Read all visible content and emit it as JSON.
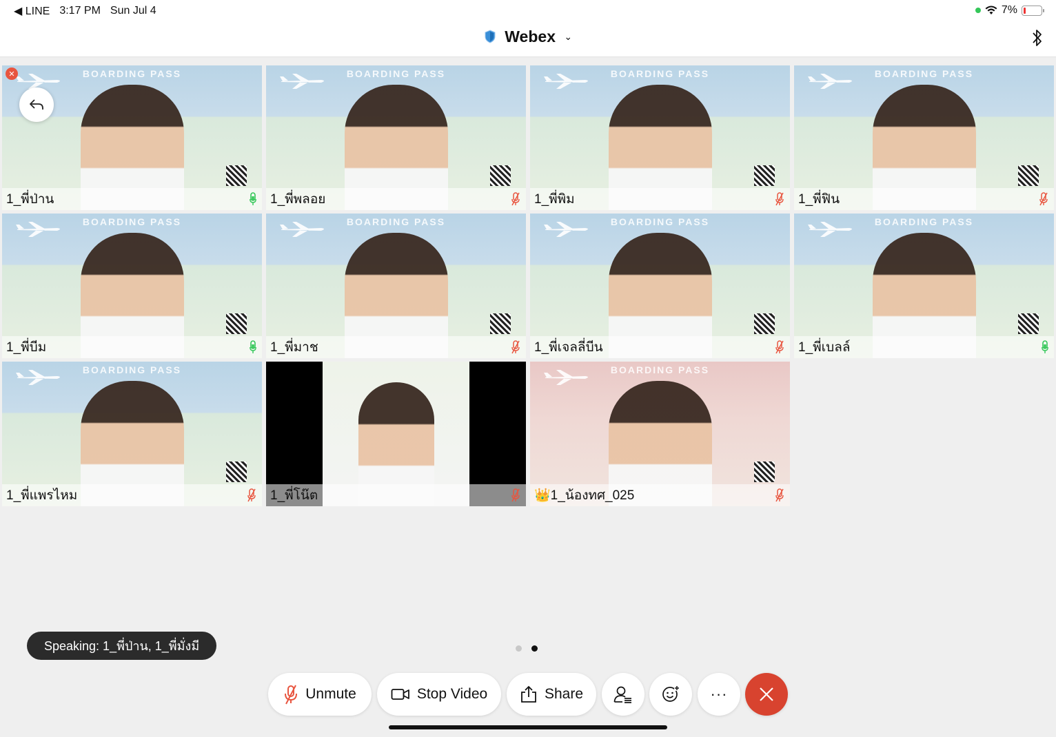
{
  "status_bar": {
    "back_app": "◀ LINE",
    "time": "3:17 PM",
    "date": "Sun Jul 4",
    "battery": "7%"
  },
  "header": {
    "title": "Webex",
    "chevron": "⌄"
  },
  "tile_overlay": {
    "banner": "BOARDING PASS"
  },
  "participants": [
    {
      "name": "1_พี่ป่าน",
      "mic": "on"
    },
    {
      "name": "1_พี่พลอย",
      "mic": "off"
    },
    {
      "name": "1_พี่พิม",
      "mic": "off"
    },
    {
      "name": "1_พี่ฟิน",
      "mic": "off"
    },
    {
      "name": "1_พี่บีม",
      "mic": "on"
    },
    {
      "name": "1_พี่มาช",
      "mic": "off"
    },
    {
      "name": "1_พี่เจลลี่บีน",
      "mic": "off"
    },
    {
      "name": "1_พี่เบลล์",
      "mic": "on"
    },
    {
      "name": "1_พี่แพรไหม",
      "mic": "off"
    },
    {
      "name": "1_พี่โน๊ต",
      "mic": "off"
    },
    {
      "name": "👑1_น้องทศ_025",
      "mic": "off"
    }
  ],
  "speaking": "Speaking: 1_พี่ป่าน, 1_พี่มั่งมี",
  "pager": {
    "pages": 2,
    "active": 2
  },
  "controls": {
    "unmute": "Unmute",
    "stop_video": "Stop Video",
    "share": "Share",
    "more": "···"
  },
  "colors": {
    "mic_on": "#34c759",
    "mic_off": "#e8553f",
    "end_call": "#d8432f"
  }
}
